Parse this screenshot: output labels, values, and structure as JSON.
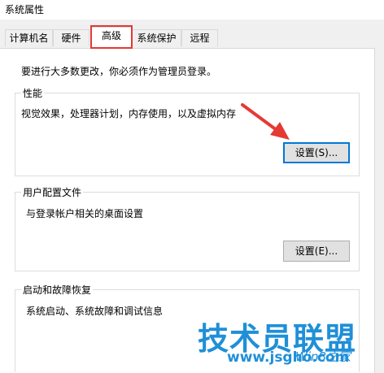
{
  "window": {
    "title": "系统属性"
  },
  "tabs": [
    {
      "label": "计算机名"
    },
    {
      "label": "硬件"
    },
    {
      "label": "高级"
    },
    {
      "label": "系统保护"
    },
    {
      "label": "远程"
    }
  ],
  "notice": "要进行大多数更改，你必须作为管理员登录。",
  "performance": {
    "label": "性能",
    "description": "视觉效果，处理器计划，内存使用，以及虚拟内存",
    "button": "设置(S)..."
  },
  "user_profiles": {
    "label": "用户配置文件",
    "description": "与登录帐户相关的桌面设置",
    "button": "设置(E)..."
  },
  "startup_recovery": {
    "label": "启动和故障恢复",
    "description": "系统启动、系统故障和调试信息"
  },
  "watermark": {
    "brand": "技术员联盟",
    "url": "www.jsgho.com",
    "small": "Win8之家"
  },
  "colors": {
    "highlight": "#e53935",
    "accent": "#0078d7",
    "watermark": "#1f8fd8"
  }
}
